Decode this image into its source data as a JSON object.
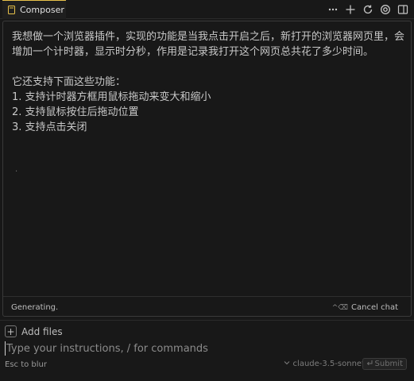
{
  "tab": {
    "title": "Composer",
    "icon": "composer-icon",
    "unsaved_color": "#e8b44a"
  },
  "toolbar": {
    "icons": [
      "more-icon",
      "plus-icon",
      "refresh-icon",
      "history-icon",
      "panel-icon"
    ]
  },
  "chat": {
    "paragraph1": "我想做一个浏览器插件，实现的功能是当我点击开启之后，新打开的浏览器网页里，会增加一个计时器，显示时分秒，作用是记录我打开这个网页总共花了多少时间。",
    "paragraph2_heading": "它还支持下面这些功能：",
    "features": [
      "1. 支持计时器方框用鼠标拖动来变大和缩小",
      "2. 支持鼠标按住后拖动位置",
      "3. 支持点击关闭"
    ],
    "trailing": "."
  },
  "status": {
    "text": "Generating.",
    "cancel_shortcut": "^⌫",
    "cancel_label": "Cancel chat"
  },
  "input": {
    "add_files_label": "Add files",
    "placeholder": "Type your instructions, / for commands",
    "value": "",
    "esc_hint": "Esc to blur",
    "model": "claude-3.5-sonnet",
    "submit_label": "Submit"
  }
}
